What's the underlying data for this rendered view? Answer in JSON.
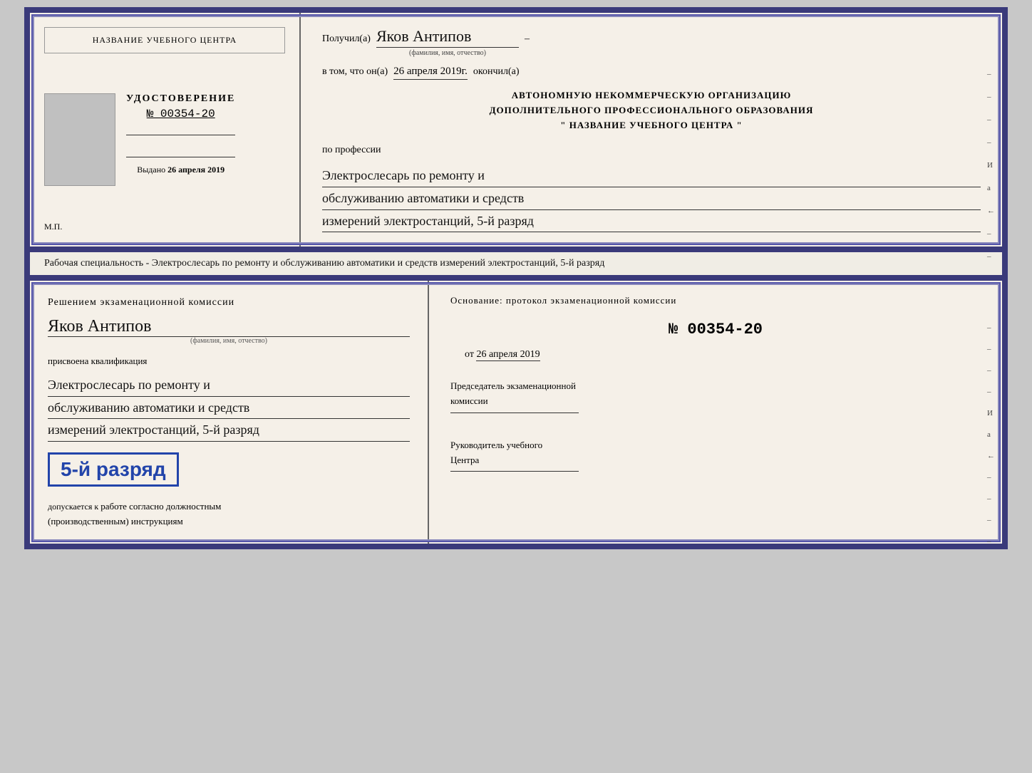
{
  "top_cert": {
    "left": {
      "school_name": "НАЗВАНИЕ УЧЕБНОГО ЦЕНТРА",
      "cert_title": "УДОСТОВЕРЕНИЕ",
      "cert_number": "№ 00354-20",
      "issued_label": "Выдано",
      "issued_date": "26 апреля 2019",
      "mp_label": "М.П."
    },
    "right": {
      "received_label": "Получил(а)",
      "recipient_name": "Яков Антипов",
      "fio_label": "(фамилия, имя, отчество)",
      "date_line_prefix": "в том, что он(а)",
      "date_handwritten": "26 апреля 2019г.",
      "date_suffix": "окончил(а)",
      "org_line1": "АВТОНОМНУЮ НЕКОММЕРЧЕСКУЮ ОРГАНИЗАЦИЮ",
      "org_line2": "ДОПОЛНИТЕЛЬНОГО ПРОФЕССИОНАЛЬНОГО ОБРАЗОВАНИЯ",
      "org_quote": "\"  НАЗВАНИЕ УЧЕБНОГО ЦЕНТРА  \"",
      "profession_label": "по профессии",
      "profession_line1": "Электрослесарь по ремонту и",
      "profession_line2": "обслуживанию автоматики и средств",
      "profession_line3": "измерений электростанций, 5-й разряд",
      "side_marks": [
        "–",
        "–",
        "–",
        "–",
        "И",
        "а",
        "←",
        "–",
        "–",
        "–",
        "–"
      ]
    }
  },
  "description": {
    "text": "Рабочая специальность - Электрослесарь по ремонту и обслуживанию автоматики и средств измерений электростанций, 5-й разряд"
  },
  "bottom_cert": {
    "left": {
      "commission_title": "Решением экзаменационной комиссии",
      "person_name": "Яков Антипов",
      "fio_label": "(фамилия, имя, отчество)",
      "assigned_label": "присвоена квалификация",
      "profession_line1": "Электрослесарь по ремонту и",
      "profession_line2": "обслуживанию автоматики и средств",
      "profession_line3": "измерений электростанций, 5-й разряд",
      "rank_badge": "5-й разряд",
      "допускается_prefix": "допускается к",
      "допускается_handwritten": "работе согласно должностным",
      "инструкциям": "(производственным) инструкциям"
    },
    "right": {
      "basis_label": "Основание: протокол экзаменационной комиссии",
      "protocol_number": "№  00354-20",
      "date_prefix": "от",
      "date_value": "26 апреля 2019",
      "chairman_title_line1": "Председатель экзаменационной",
      "chairman_title_line2": "комиссии",
      "director_title_line1": "Руководитель учебного",
      "director_title_line2": "Центра",
      "side_marks": [
        "–",
        "–",
        "–",
        "–",
        "И",
        "а",
        "←",
        "–",
        "–",
        "–",
        "–"
      ]
    }
  }
}
